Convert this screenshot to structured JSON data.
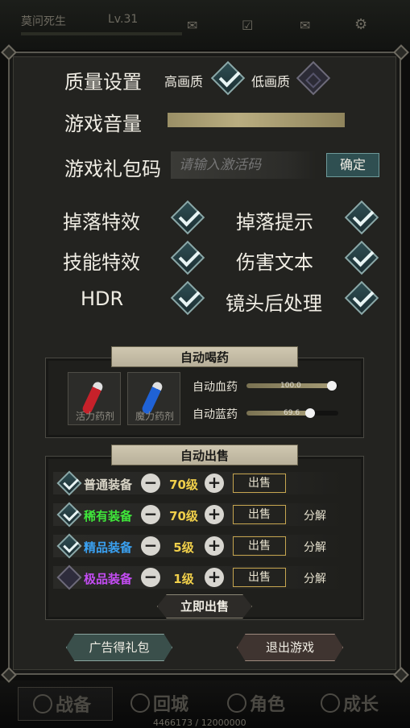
{
  "hud": {
    "player_name": "莫问死生",
    "level": "Lv.31",
    "exp": "4466173 / 12000000"
  },
  "bottom_nav": [
    {
      "label": "战备"
    },
    {
      "label": "回城"
    },
    {
      "label": "角色"
    },
    {
      "label": "成长"
    }
  ],
  "settings": {
    "quality_label": "质量设置",
    "quality_high": "高画质",
    "quality_low": "低画质",
    "quality_selected": "高画质",
    "volume_label": "游戏音量",
    "volume_level": 1.0,
    "gift_label": "游戏礼包码",
    "gift_placeholder": "请输入激活码",
    "confirm_label": "确定",
    "toggles": [
      {
        "label": "掉落特效",
        "checked": true
      },
      {
        "label": "掉落提示",
        "checked": true
      },
      {
        "label": "技能特效",
        "checked": true
      },
      {
        "label": "伤害文本",
        "checked": true
      },
      {
        "label": "HDR",
        "checked": true
      },
      {
        "label": "镜头后处理",
        "checked": true
      }
    ]
  },
  "auto_potion": {
    "title": "自动喝药",
    "hp_potion": "活力药剂",
    "mp_potion": "魔力药剂",
    "hp_label": "自动血药",
    "hp_value": "100.0",
    "hp_fraction": 1.0,
    "mp_label": "自动蓝药",
    "mp_value": "69.6",
    "mp_fraction": 0.696
  },
  "auto_sell": {
    "title": "自动出售",
    "sell_label": "出售",
    "decompose_label": "分解",
    "sell_now": "立即出售",
    "rows": [
      {
        "name": "普通装备",
        "color": "#d8d4c6",
        "level": "70级",
        "checked": true,
        "decompose": ""
      },
      {
        "name": "稀有装备",
        "color": "#3fe63a",
        "level": "70级",
        "checked": true,
        "decompose": "分解"
      },
      {
        "name": "精品装备",
        "color": "#3aa0f0",
        "level": "5级",
        "checked": true,
        "decompose": "分解"
      },
      {
        "name": "极品装备",
        "color": "#c34cf2",
        "level": "1级",
        "checked": false,
        "decompose": "分解"
      }
    ]
  },
  "footer": {
    "ad_label": "广告得礼包",
    "exit_label": "退出游戏"
  }
}
